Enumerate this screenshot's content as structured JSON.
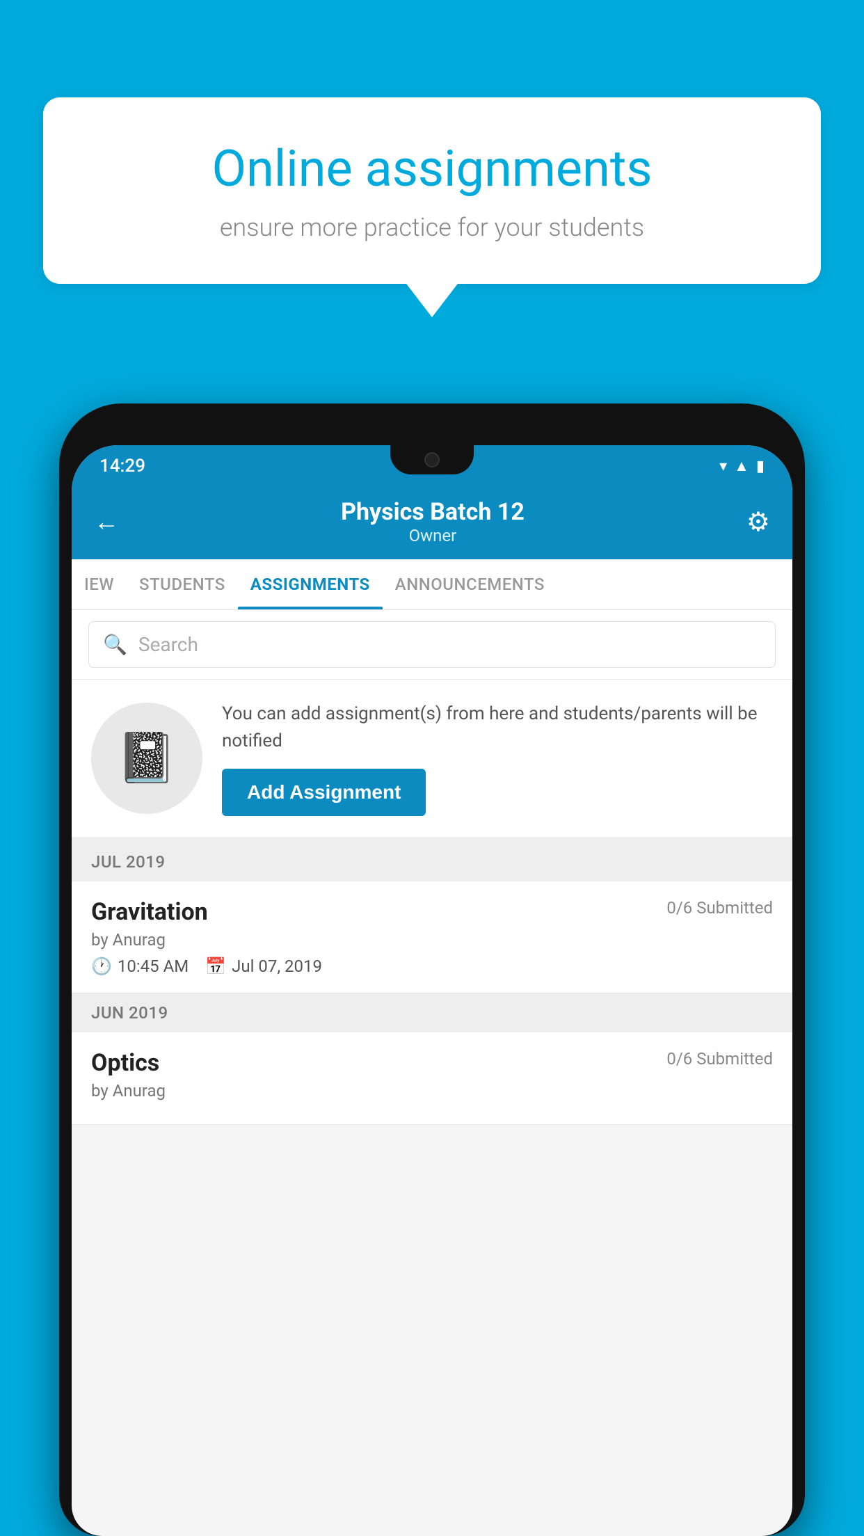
{
  "background_color": "#00AADD",
  "speech_bubble": {
    "title": "Online assignments",
    "subtitle": "ensure more practice for your students"
  },
  "status_bar": {
    "time": "14:29",
    "icons": [
      "wifi",
      "signal",
      "battery"
    ]
  },
  "header": {
    "title": "Physics Batch 12",
    "subtitle": "Owner",
    "back_label": "←",
    "settings_label": "⚙"
  },
  "tabs": [
    {
      "id": "review",
      "label": "IEW",
      "active": false
    },
    {
      "id": "students",
      "label": "STUDENTS",
      "active": false
    },
    {
      "id": "assignments",
      "label": "ASSIGNMENTS",
      "active": true
    },
    {
      "id": "announcements",
      "label": "ANNOUNCEMENTS",
      "active": false
    }
  ],
  "search": {
    "placeholder": "Search"
  },
  "add_assignment": {
    "info_text": "You can add assignment(s) from here and students/parents will be notified",
    "button_label": "Add Assignment"
  },
  "sections": [
    {
      "month": "JUL 2019",
      "assignments": [
        {
          "name": "Gravitation",
          "submitted": "0/6 Submitted",
          "by": "by Anurag",
          "time": "10:45 AM",
          "date": "Jul 07, 2019"
        }
      ]
    },
    {
      "month": "JUN 2019",
      "assignments": [
        {
          "name": "Optics",
          "submitted": "0/6 Submitted",
          "by": "by Anurag",
          "time": "",
          "date": ""
        }
      ]
    }
  ]
}
